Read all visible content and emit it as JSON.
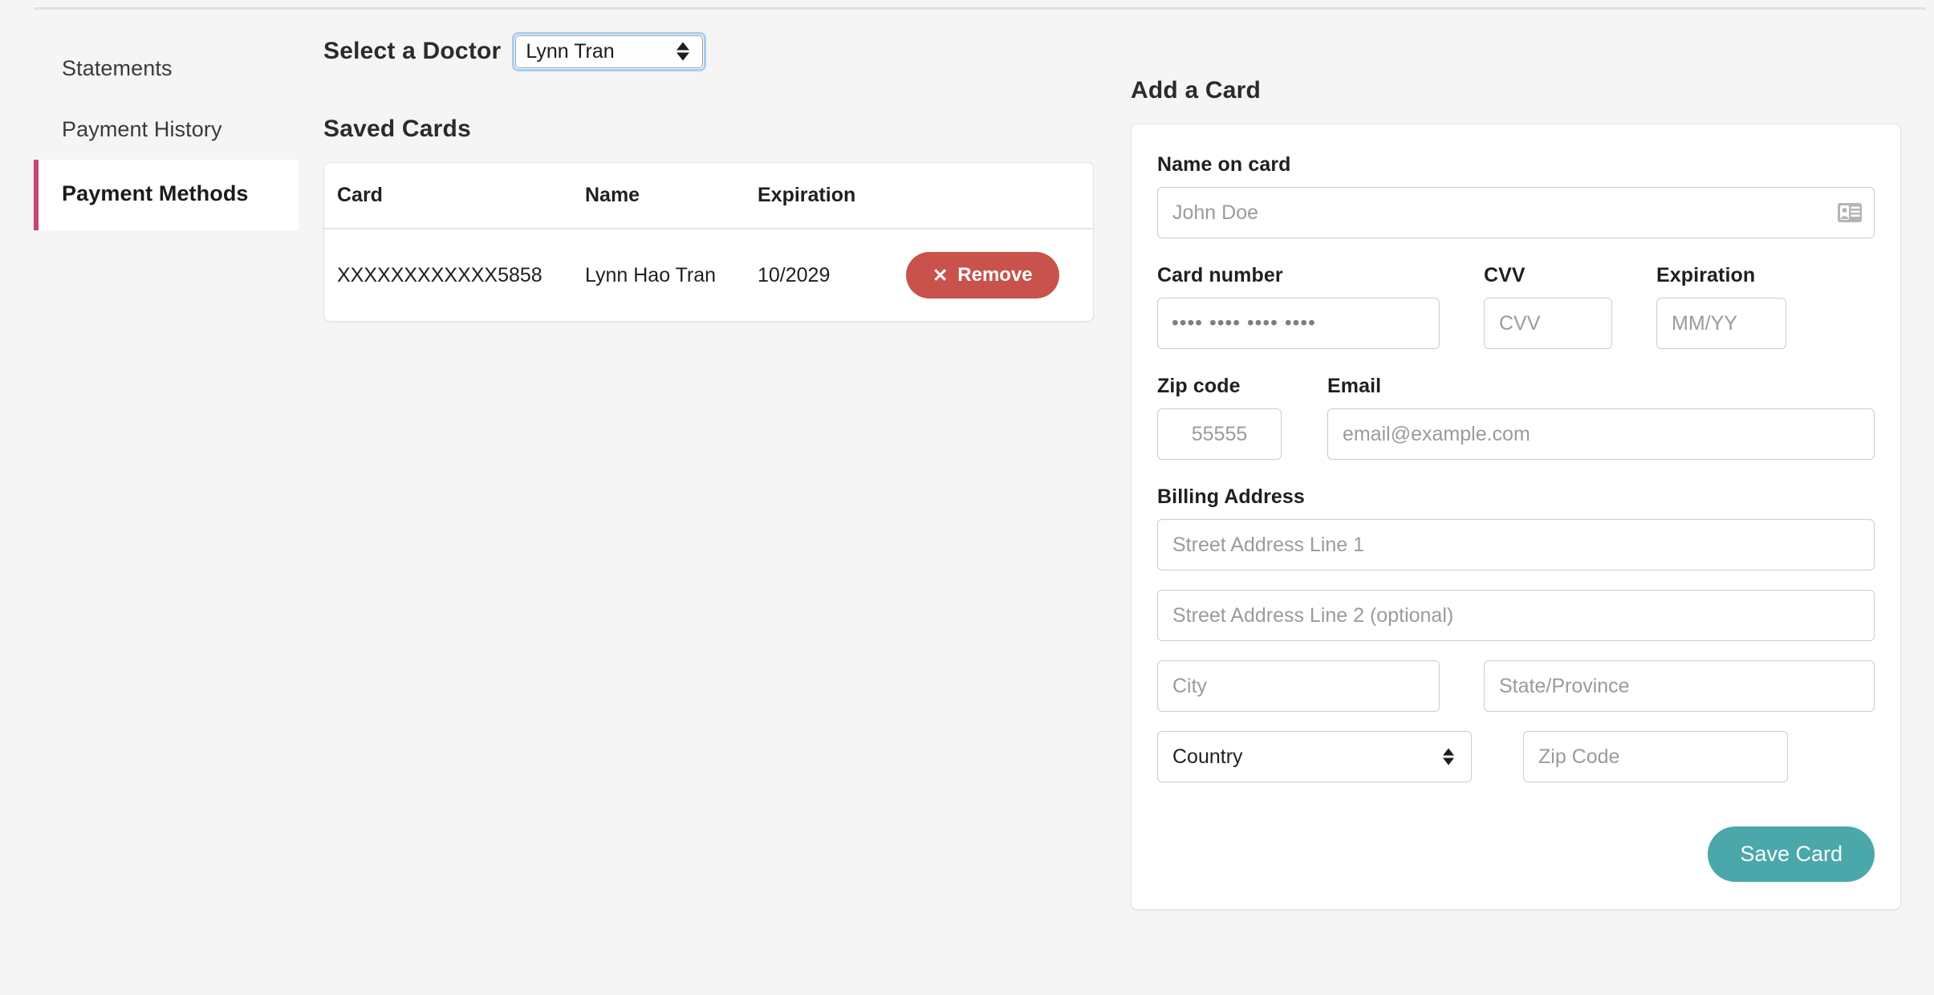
{
  "sidebar": {
    "items": [
      {
        "label": "Statements",
        "active": false
      },
      {
        "label": "Payment History",
        "active": false
      },
      {
        "label": "Payment Methods",
        "active": true
      }
    ]
  },
  "doctor_selector": {
    "label": "Select a Doctor",
    "selected": "Lynn Tran",
    "options": [
      "Lynn Tran"
    ]
  },
  "saved_cards": {
    "title": "Saved Cards",
    "columns": [
      "Card",
      "Name",
      "Expiration",
      ""
    ],
    "rows": [
      {
        "card": "XXXXXXXXXXXX5858",
        "name": "Lynn Hao Tran",
        "expiration": "10/2029",
        "remove_label": "Remove",
        "remove_icon": "close-x-icon"
      }
    ]
  },
  "add_card": {
    "title": "Add a Card",
    "name_on_card": {
      "label": "Name on card",
      "value": "",
      "placeholder": "John Doe",
      "icon": "id-card-icon"
    },
    "card_number": {
      "label": "Card number",
      "value": "",
      "placeholder": "•••• •••• •••• ••••"
    },
    "cvv": {
      "label": "CVV",
      "value": "",
      "placeholder": "CVV"
    },
    "expiration": {
      "label": "Expiration",
      "value": "",
      "placeholder": "MM/YY"
    },
    "zip_code_top": {
      "label": "Zip code",
      "value": "",
      "placeholder": "55555"
    },
    "email": {
      "label": "Email",
      "value": "",
      "placeholder": "email@example.com"
    },
    "billing_address": {
      "label": "Billing Address",
      "street1_placeholder": "Street Address Line 1",
      "street2_placeholder": "Street Address Line 2 (optional)",
      "city_placeholder": "City",
      "state_placeholder": "State/Province",
      "country_selected": "Country",
      "country_options": [
        "Country"
      ],
      "zip_placeholder": "Zip Code"
    },
    "save_label": "Save Card"
  },
  "colors": {
    "page_bg": "#f5f5f5",
    "accent_active": "#c8456d",
    "remove_btn": "#c9524c",
    "save_btn": "#4aa8ab",
    "focus_ring": "#a8cdf0"
  }
}
